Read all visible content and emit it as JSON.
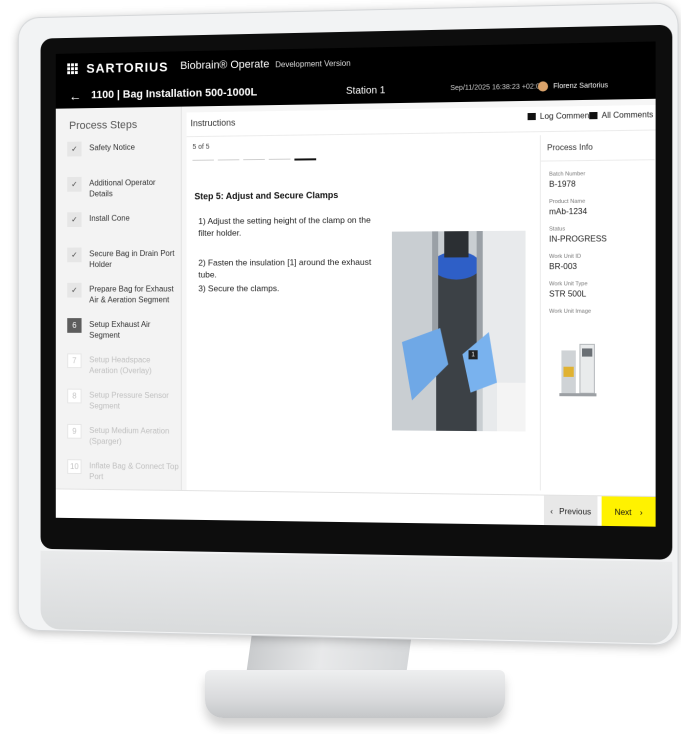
{
  "topbar": {
    "brand": "SARTORIUS",
    "app_name": "Biobrain® Operate",
    "dev_version": "Development Version",
    "station": "Station 1",
    "datetime": "Sep/11/2025 16:38:23 +02:00",
    "user": "Florenz Sartorius"
  },
  "header": {
    "back_icon": "arrow-left-icon",
    "title": "1100 | Bag Installation 500-1000L"
  },
  "sidebar": {
    "title": "Process Steps",
    "steps": [
      {
        "label": "Safety Notice",
        "status": "done",
        "marker": "✓"
      },
      {
        "label": "Additional Operator Details",
        "status": "done",
        "marker": "✓"
      },
      {
        "label": "Install Cone",
        "status": "done",
        "marker": "✓"
      },
      {
        "label": "Secure Bag in Drain Port Holder",
        "status": "done",
        "marker": "✓"
      },
      {
        "label": "Prepare Bag for Exhaust Air & Aeration Segment",
        "status": "done",
        "marker": "✓"
      },
      {
        "label": "Setup Exhaust Air Segment",
        "status": "current",
        "marker": "6"
      },
      {
        "label": "Setup Headspace Aeration (Overlay)",
        "status": "pending",
        "marker": "7"
      },
      {
        "label": "Setup Pressure Sensor Segment",
        "status": "pending",
        "marker": "8"
      },
      {
        "label": "Setup Medium Aeration (Sparger)",
        "status": "pending",
        "marker": "9"
      },
      {
        "label": "Inflate Bag & Connect Top Port",
        "status": "pending",
        "marker": "10"
      }
    ]
  },
  "instructions": {
    "title": "Instructions",
    "log_comment": "Log Comment",
    "all_comments": "All Comments",
    "step_count": "5 of 5",
    "progress_current": 5,
    "progress_total": 5,
    "heading": "Step 5: Adjust and Secure Clamps",
    "lines": [
      "1) Adjust the setting height of the clamp on the filter holder.",
      "2) Fasten the insulation [1] around the exhaust tube.",
      "3) Secure the clamps."
    ],
    "photo_marker": "1"
  },
  "process_info": {
    "title": "Process Info",
    "fields": [
      {
        "label": "Batch Number",
        "value": "B-1978"
      },
      {
        "label": "Product Name",
        "value": "mAb-1234"
      },
      {
        "label": "Status",
        "value": "IN-PROGRESS"
      },
      {
        "label": "Work Unit ID",
        "value": "BR-003"
      },
      {
        "label": "Work Unit Type",
        "value": "STR 500L"
      }
    ],
    "image_label": "Work Unit Image"
  },
  "footer": {
    "previous": "Previous",
    "next": "Next",
    "prev_icon": "‹",
    "next_icon": "›"
  },
  "colors": {
    "accent": "#fff200",
    "topbar": "#000000"
  }
}
